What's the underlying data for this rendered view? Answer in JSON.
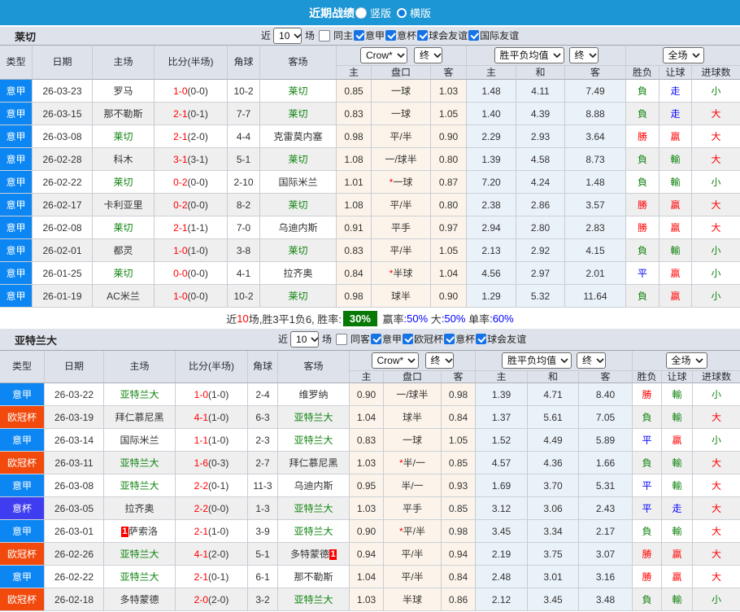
{
  "titlebar": {
    "title": "近期战绩",
    "view_options": [
      {
        "label": "竖版",
        "selected": true
      },
      {
        "label": "横版",
        "selected": false
      }
    ]
  },
  "colors": {
    "titlebar_bg": "#1c96d4",
    "toolbar_bg": "#dee2eb",
    "header_bg": "#dee2eb",
    "row_alt_bg": "#efefef",
    "handicap_group_bg": "#fcf4ea",
    "avg_group_bg": "#eaf2f9",
    "team_self_green": "#108410",
    "score_red": "#ff0000",
    "checkbox_blue": "#1673e6",
    "summary_badge_green": "#067806"
  },
  "league_colors": {
    "意甲": "#0b86f3",
    "欧冠杯": "#f24a0d",
    "意杯": "#3e3ef0"
  },
  "result_colors": {
    "勝": "#f00",
    "贏": "#f00",
    "大": "#f00",
    "負": "#108410",
    "輸": "#108410",
    "小": "#108410",
    "平": "#00f",
    "走": "#00f"
  },
  "sections": [
    {
      "team": "莱切",
      "toolbar": {
        "near_label": "近",
        "games": "10",
        "games_suffix": "场",
        "same_label": "同主",
        "same_checked": false,
        "leagues": [
          {
            "label": "意甲",
            "checked": true
          },
          {
            "label": "意杯",
            "checked": true
          },
          {
            "label": "球会友谊",
            "checked": true
          },
          {
            "label": "国际友谊",
            "checked": true
          }
        ]
      },
      "header": {
        "cols": [
          "类型",
          "日期",
          "主场",
          "比分(半场)",
          "角球",
          "客场"
        ],
        "bookmaker_select": "Crow*",
        "final_select_1": "终",
        "avg_select": "胜平负均值",
        "final_select_2": "终",
        "scope_select": "全场",
        "sub_handicap": [
          "主",
          "盘口",
          "客"
        ],
        "sub_avg": [
          "主",
          "和",
          "客"
        ],
        "sub_result": [
          "胜负",
          "让球",
          "进球数"
        ]
      },
      "rows": [
        {
          "league": "意甲",
          "date": "26-03-23",
          "home": "罗马",
          "home_self": false,
          "home_badge": "",
          "score_ft": "1-0",
          "score_ht": "(0-0)",
          "corners": "10-2",
          "away": "莱切",
          "away_self": true,
          "away_badge": "",
          "odds_home": "0.85",
          "handicap_star": "",
          "handicap": "一球",
          "odds_away": "1.03",
          "avg_home": "1.48",
          "avg_draw": "4.11",
          "avg_away": "7.49",
          "res_wdl": "負",
          "res_let": "走",
          "res_goal": "小"
        },
        {
          "league": "意甲",
          "date": "26-03-15",
          "home": "那不勒斯",
          "home_self": false,
          "home_badge": "",
          "score_ft": "2-1",
          "score_ht": "(0-1)",
          "corners": "7-7",
          "away": "莱切",
          "away_self": true,
          "away_badge": "",
          "odds_home": "0.83",
          "handicap_star": "",
          "handicap": "一球",
          "odds_away": "1.05",
          "avg_home": "1.40",
          "avg_draw": "4.39",
          "avg_away": "8.88",
          "res_wdl": "負",
          "res_let": "走",
          "res_goal": "大"
        },
        {
          "league": "意甲",
          "date": "26-03-08",
          "home": "莱切",
          "home_self": true,
          "home_badge": "",
          "score_ft": "2-1",
          "score_ht": "(2-0)",
          "corners": "4-4",
          "away": "克雷莫内塞",
          "away_self": false,
          "away_badge": "",
          "odds_home": "0.98",
          "handicap_star": "",
          "handicap": "平/半",
          "odds_away": "0.90",
          "avg_home": "2.29",
          "avg_draw": "2.93",
          "avg_away": "3.64",
          "res_wdl": "勝",
          "res_let": "贏",
          "res_goal": "大"
        },
        {
          "league": "意甲",
          "date": "26-02-28",
          "home": "科木",
          "home_self": false,
          "home_badge": "",
          "score_ft": "3-1",
          "score_ht": "(3-1)",
          "corners": "5-1",
          "away": "莱切",
          "away_self": true,
          "away_badge": "",
          "odds_home": "1.08",
          "handicap_star": "",
          "handicap": "一/球半",
          "odds_away": "0.80",
          "avg_home": "1.39",
          "avg_draw": "4.58",
          "avg_away": "8.73",
          "res_wdl": "負",
          "res_let": "輸",
          "res_goal": "大"
        },
        {
          "league": "意甲",
          "date": "26-02-22",
          "home": "莱切",
          "home_self": true,
          "home_badge": "",
          "score_ft": "0-2",
          "score_ht": "(0-0)",
          "corners": "2-10",
          "away": "国际米兰",
          "away_self": false,
          "away_badge": "",
          "odds_home": "1.01",
          "handicap_star": "*",
          "handicap": "一球",
          "odds_away": "0.87",
          "avg_home": "7.20",
          "avg_draw": "4.24",
          "avg_away": "1.48",
          "res_wdl": "負",
          "res_let": "輸",
          "res_goal": "小"
        },
        {
          "league": "意甲",
          "date": "26-02-17",
          "home": "卡利亚里",
          "home_self": false,
          "home_badge": "",
          "score_ft": "0-2",
          "score_ht": "(0-0)",
          "corners": "8-2",
          "away": "莱切",
          "away_self": true,
          "away_badge": "",
          "odds_home": "1.08",
          "handicap_star": "",
          "handicap": "平/半",
          "odds_away": "0.80",
          "avg_home": "2.38",
          "avg_draw": "2.86",
          "avg_away": "3.57",
          "res_wdl": "勝",
          "res_let": "贏",
          "res_goal": "大"
        },
        {
          "league": "意甲",
          "date": "26-02-08",
          "home": "莱切",
          "home_self": true,
          "home_badge": "",
          "score_ft": "2-1",
          "score_ht": "(1-1)",
          "corners": "7-0",
          "away": "乌迪内斯",
          "away_self": false,
          "away_badge": "",
          "odds_home": "0.91",
          "handicap_star": "",
          "handicap": "平手",
          "odds_away": "0.97",
          "avg_home": "2.94",
          "avg_draw": "2.80",
          "avg_away": "2.83",
          "res_wdl": "勝",
          "res_let": "贏",
          "res_goal": "大"
        },
        {
          "league": "意甲",
          "date": "26-02-01",
          "home": "都灵",
          "home_self": false,
          "home_badge": "",
          "score_ft": "1-0",
          "score_ht": "(1-0)",
          "corners": "3-8",
          "away": "莱切",
          "away_self": true,
          "away_badge": "",
          "odds_home": "0.83",
          "handicap_star": "",
          "handicap": "平/半",
          "odds_away": "1.05",
          "avg_home": "2.13",
          "avg_draw": "2.92",
          "avg_away": "4.15",
          "res_wdl": "負",
          "res_let": "輸",
          "res_goal": "小"
        },
        {
          "league": "意甲",
          "date": "26-01-25",
          "home": "莱切",
          "home_self": true,
          "home_badge": "",
          "score_ft": "0-0",
          "score_ht": "(0-0)",
          "corners": "4-1",
          "away": "拉齐奥",
          "away_self": false,
          "away_badge": "",
          "odds_home": "0.84",
          "handicap_star": "*",
          "handicap": "半球",
          "odds_away": "1.04",
          "avg_home": "4.56",
          "avg_draw": "2.97",
          "avg_away": "2.01",
          "res_wdl": "平",
          "res_let": "贏",
          "res_goal": "小"
        },
        {
          "league": "意甲",
          "date": "26-01-19",
          "home": "AC米兰",
          "home_self": false,
          "home_badge": "",
          "score_ft": "1-0",
          "score_ht": "(0-0)",
          "corners": "10-2",
          "away": "莱切",
          "away_self": true,
          "away_badge": "",
          "odds_home": "0.98",
          "handicap_star": "",
          "handicap": "球半",
          "odds_away": "0.90",
          "avg_home": "1.29",
          "avg_draw": "5.32",
          "avg_away": "11.64",
          "res_wdl": "負",
          "res_let": "贏",
          "res_goal": "小"
        }
      ],
      "summary": [
        {
          "text": "近",
          "style": "plain"
        },
        {
          "text": "10",
          "style": "red"
        },
        {
          "text": "场,胜3平1负6, 胜率:",
          "style": "plain"
        },
        {
          "text": "30%",
          "style": "badge"
        },
        {
          "text": " 赢率",
          "style": "plain"
        },
        {
          "text": ":50%",
          "style": "blue"
        },
        {
          "text": " 大",
          "style": "plain"
        },
        {
          "text": ":50%",
          "style": "blue"
        },
        {
          "text": " 单率",
          "style": "plain"
        },
        {
          "text": ":60%",
          "style": "blue"
        }
      ]
    },
    {
      "team": "亚特兰大",
      "toolbar": {
        "near_label": "近",
        "games": "10",
        "games_suffix": "场",
        "same_label": "同客",
        "same_checked": false,
        "leagues": [
          {
            "label": "意甲",
            "checked": true
          },
          {
            "label": "欧冠杯",
            "checked": true
          },
          {
            "label": "意杯",
            "checked": true
          },
          {
            "label": "球会友谊",
            "checked": true
          }
        ]
      },
      "header": {
        "cols": [
          "类型",
          "日期",
          "主场",
          "比分(半场)",
          "角球",
          "客场"
        ],
        "bookmaker_select": "Crow*",
        "final_select_1": "终",
        "avg_select": "胜平负均值",
        "final_select_2": "终",
        "scope_select": "全场",
        "sub_handicap": [
          "主",
          "盘口",
          "客"
        ],
        "sub_avg": [
          "主",
          "和",
          "客"
        ],
        "sub_result": [
          "胜负",
          "让球",
          "进球数"
        ]
      },
      "rows": [
        {
          "league": "意甲",
          "date": "26-03-22",
          "home": "亚特兰大",
          "home_self": true,
          "home_badge": "",
          "score_ft": "1-0",
          "score_ht": "(1-0)",
          "corners": "2-4",
          "away": "维罗纳",
          "away_self": false,
          "away_badge": "",
          "odds_home": "0.90",
          "handicap_star": "",
          "handicap": "一/球半",
          "odds_away": "0.98",
          "avg_home": "1.39",
          "avg_draw": "4.71",
          "avg_away": "8.40",
          "res_wdl": "勝",
          "res_let": "輸",
          "res_goal": "小"
        },
        {
          "league": "欧冠杯",
          "date": "26-03-19",
          "home": "拜仁慕尼黑",
          "home_self": false,
          "home_badge": "",
          "score_ft": "4-1",
          "score_ht": "(1-0)",
          "corners": "6-3",
          "away": "亚特兰大",
          "away_self": true,
          "away_badge": "",
          "odds_home": "1.04",
          "handicap_star": "",
          "handicap": "球半",
          "odds_away": "0.84",
          "avg_home": "1.37",
          "avg_draw": "5.61",
          "avg_away": "7.05",
          "res_wdl": "負",
          "res_let": "輸",
          "res_goal": "大"
        },
        {
          "league": "意甲",
          "date": "26-03-14",
          "home": "国际米兰",
          "home_self": false,
          "home_badge": "",
          "score_ft": "1-1",
          "score_ht": "(1-0)",
          "corners": "2-3",
          "away": "亚特兰大",
          "away_self": true,
          "away_badge": "",
          "odds_home": "0.83",
          "handicap_star": "",
          "handicap": "一球",
          "odds_away": "1.05",
          "avg_home": "1.52",
          "avg_draw": "4.49",
          "avg_away": "5.89",
          "res_wdl": "平",
          "res_let": "贏",
          "res_goal": "小"
        },
        {
          "league": "欧冠杯",
          "date": "26-03-11",
          "home": "亚特兰大",
          "home_self": true,
          "home_badge": "",
          "score_ft": "1-6",
          "score_ht": "(0-3)",
          "corners": "2-7",
          "away": "拜仁慕尼黑",
          "away_self": false,
          "away_badge": "",
          "odds_home": "1.03",
          "handicap_star": "*",
          "handicap": "半/一",
          "odds_away": "0.85",
          "avg_home": "4.57",
          "avg_draw": "4.36",
          "avg_away": "1.66",
          "res_wdl": "負",
          "res_let": "輸",
          "res_goal": "大"
        },
        {
          "league": "意甲",
          "date": "26-03-08",
          "home": "亚特兰大",
          "home_self": true,
          "home_badge": "",
          "score_ft": "2-2",
          "score_ht": "(0-1)",
          "corners": "11-3",
          "away": "乌迪内斯",
          "away_self": false,
          "away_badge": "",
          "odds_home": "0.95",
          "handicap_star": "",
          "handicap": "半/一",
          "odds_away": "0.93",
          "avg_home": "1.69",
          "avg_draw": "3.70",
          "avg_away": "5.31",
          "res_wdl": "平",
          "res_let": "輸",
          "res_goal": "大"
        },
        {
          "league": "意杯",
          "date": "26-03-05",
          "home": "拉齐奥",
          "home_self": false,
          "home_badge": "",
          "score_ft": "2-2",
          "score_ht": "(0-0)",
          "corners": "1-3",
          "away": "亚特兰大",
          "away_self": true,
          "away_badge": "",
          "odds_home": "1.03",
          "handicap_star": "",
          "handicap": "平手",
          "odds_away": "0.85",
          "avg_home": "3.12",
          "avg_draw": "3.06",
          "avg_away": "2.43",
          "res_wdl": "平",
          "res_let": "走",
          "res_goal": "大"
        },
        {
          "league": "意甲",
          "date": "26-03-01",
          "home": "萨索洛",
          "home_self": false,
          "home_badge": "1",
          "score_ft": "2-1",
          "score_ht": "(1-0)",
          "corners": "3-9",
          "away": "亚特兰大",
          "away_self": true,
          "away_badge": "",
          "odds_home": "0.90",
          "handicap_star": "*",
          "handicap": "平/半",
          "odds_away": "0.98",
          "avg_home": "3.45",
          "avg_draw": "3.34",
          "avg_away": "2.17",
          "res_wdl": "負",
          "res_let": "輸",
          "res_goal": "大"
        },
        {
          "league": "欧冠杯",
          "date": "26-02-26",
          "home": "亚特兰大",
          "home_self": true,
          "home_badge": "",
          "score_ft": "4-1",
          "score_ht": "(2-0)",
          "corners": "5-1",
          "away": "多特蒙德",
          "away_self": false,
          "away_badge": "1",
          "odds_home": "0.94",
          "handicap_star": "",
          "handicap": "平/半",
          "odds_away": "0.94",
          "avg_home": "2.19",
          "avg_draw": "3.75",
          "avg_away": "3.07",
          "res_wdl": "勝",
          "res_let": "贏",
          "res_goal": "大"
        },
        {
          "league": "意甲",
          "date": "26-02-22",
          "home": "亚特兰大",
          "home_self": true,
          "home_badge": "",
          "score_ft": "2-1",
          "score_ht": "(0-1)",
          "corners": "6-1",
          "away": "那不勒斯",
          "away_self": false,
          "away_badge": "",
          "odds_home": "1.04",
          "handicap_star": "",
          "handicap": "平/半",
          "odds_away": "0.84",
          "avg_home": "2.48",
          "avg_draw": "3.01",
          "avg_away": "3.16",
          "res_wdl": "勝",
          "res_let": "贏",
          "res_goal": "大"
        },
        {
          "league": "欧冠杯",
          "date": "26-02-18",
          "home": "多特蒙德",
          "home_self": false,
          "home_badge": "",
          "score_ft": "2-0",
          "score_ht": "(2-0)",
          "corners": "3-2",
          "away": "亚特兰大",
          "away_self": true,
          "away_badge": "",
          "odds_home": "1.03",
          "handicap_star": "",
          "handicap": "半球",
          "odds_away": "0.86",
          "avg_home": "2.12",
          "avg_draw": "3.45",
          "avg_away": "3.48",
          "res_wdl": "負",
          "res_let": "輸",
          "res_goal": "小"
        }
      ],
      "summary": []
    }
  ]
}
